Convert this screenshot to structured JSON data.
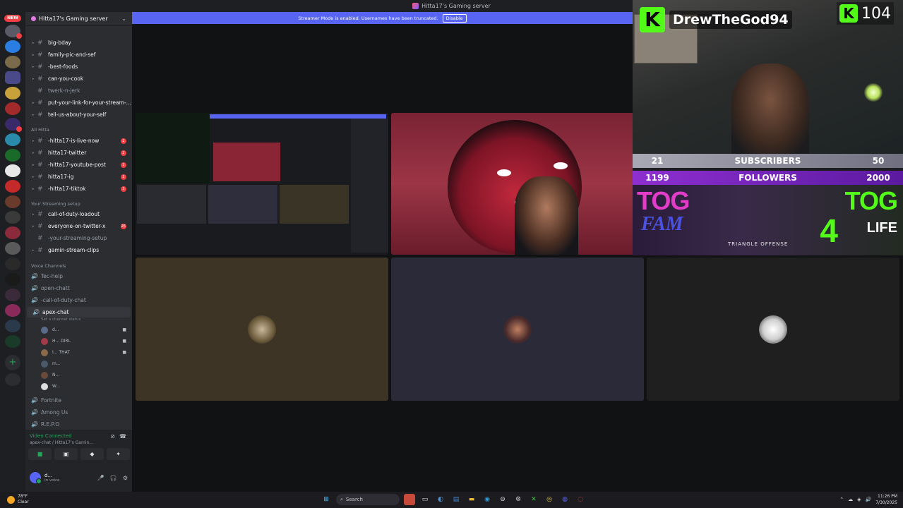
{
  "titlebar": {
    "title": "Hitta17's Gaming server"
  },
  "window_controls": {
    "minimize": "—",
    "maximize": "☐",
    "close": "✕"
  },
  "rail": {
    "new_label": "NEW"
  },
  "sidebar": {
    "server_name": "Hitta17's Gaming server",
    "channels_top": [
      {
        "label": "big-bday",
        "unread": true
      },
      {
        "label": "family-pic-and-sef",
        "unread": true
      },
      {
        "label": "-best-foods",
        "unread": true
      },
      {
        "label": "can-you-cook",
        "unread": true
      },
      {
        "label": "twerk-n-jerk",
        "unread": false
      },
      {
        "label": "put-your-link-for-your-stream-...",
        "unread": true
      },
      {
        "label": "tell-us-about-your-self",
        "unread": true
      }
    ],
    "cat_all": "All Hitta",
    "channels_hitta": [
      {
        "label": "-hitta17-is-live-now",
        "count": "2"
      },
      {
        "label": "hitta17-twitter",
        "count": "2"
      },
      {
        "label": "-hitta17-youtube-post",
        "count": "1"
      },
      {
        "label": "hitta17-ig",
        "count": "1"
      },
      {
        "label": "-hitta17-tiktok",
        "count": "3"
      }
    ],
    "cat_stream": "Your Streaming setup",
    "channels_stream": [
      {
        "label": "call-of-duty-loadout",
        "count": "",
        "unread": true
      },
      {
        "label": "everyone-on-twitter-x",
        "count": "26",
        "unread": true
      },
      {
        "label": "-your-streaming-setup",
        "count": "",
        "unread": false
      },
      {
        "label": "gamin-stream-clips",
        "count": "",
        "unread": true
      }
    ],
    "cat_voice": "Voice Channels",
    "voice_top": [
      {
        "label": "Tec-help"
      },
      {
        "label": "open-chatt"
      },
      {
        "label": "-call-of-duty-chat"
      }
    ],
    "active_voice": {
      "label": "apex-chat",
      "status": "Set a channel status"
    },
    "voice_users": [
      {
        "label": "d...",
        "color": "#5a6c8a"
      },
      {
        "label": "H... DIRL",
        "color": "#a33a4a"
      },
      {
        "label": "I... THAT",
        "color": "#8a6a4a"
      },
      {
        "label": "m...",
        "color": "#4a5a6a"
      },
      {
        "label": "N...",
        "color": "#6a4a3a"
      },
      {
        "label": "W...",
        "color": "#ddd"
      }
    ],
    "voice_bottom": [
      {
        "label": "Fortnite"
      },
      {
        "label": "Among Us"
      },
      {
        "label": "R.E.P.O"
      }
    ],
    "voice_panel": {
      "status": "Video Connected",
      "where": "apex-chat / Hitta17's Gamin..."
    },
    "user": {
      "name": "d...",
      "status": "In voice"
    }
  },
  "banner": {
    "text": "Streamer Mode is enabled. Usernames have been truncated.",
    "button": "Disable"
  },
  "overlay": {
    "streamer": "DrewTheGod94",
    "viewers": "104",
    "subs": {
      "current": "21",
      "label": "SUBSCRIBERS",
      "goal": "50"
    },
    "followers": {
      "current": "1199",
      "label": "FOLLOWERS",
      "goal": "2000"
    },
    "tog_left": "TOG",
    "fam": "FAM",
    "tog_right": "TOG",
    "four": "4",
    "life": "LIFE",
    "triangle": "TRIANGLE OFFENSE"
  },
  "taskbar": {
    "temp": "78°F",
    "weather": "Clear",
    "search": "Search",
    "time": "11:26 PM",
    "date": "7/30/2025"
  },
  "colors": {
    "discord_blurple": "#5865f2",
    "kick_green": "#53fc18",
    "unread_red": "#f23f43"
  }
}
